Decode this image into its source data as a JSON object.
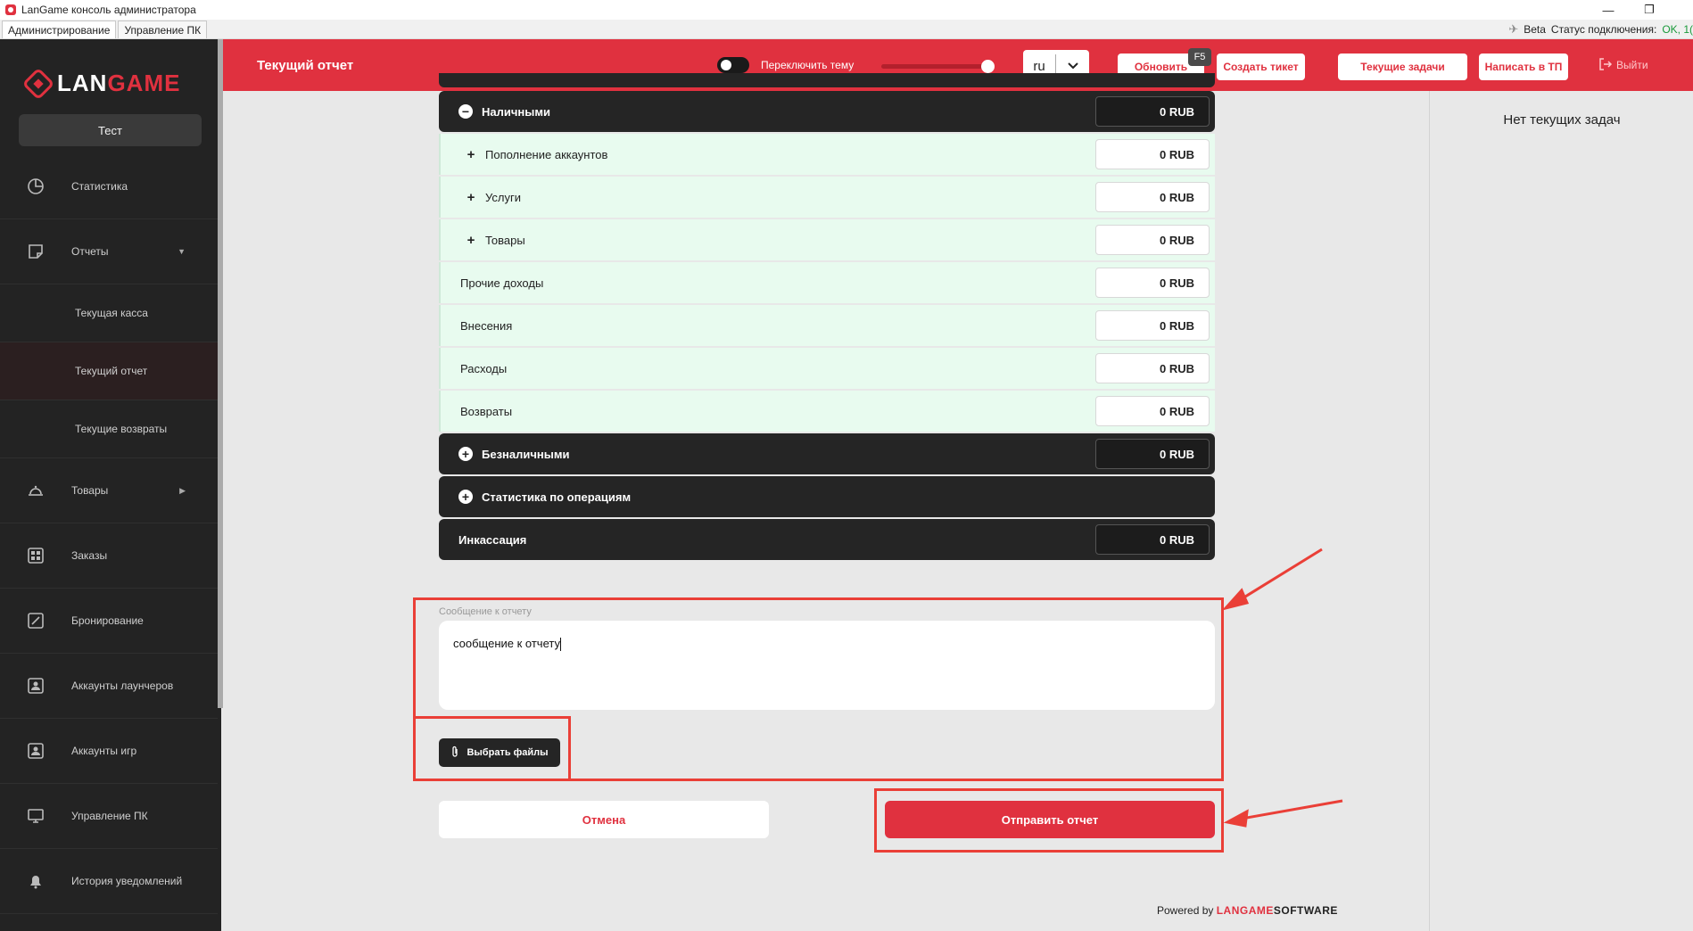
{
  "window": {
    "title": "LanGame консоль администратора",
    "tabs": [
      "Администрирование",
      "Управление ПК"
    ],
    "beta_label": "Beta",
    "status_label": "Статус подключения:",
    "status_value": "OK, 1("
  },
  "sidebar": {
    "logo_left": "LAN",
    "logo_right": "GAME",
    "club_button": "Тест",
    "items": [
      {
        "label": "Статистика",
        "icon": "pie-chart-icon"
      },
      {
        "label": "Отчеты",
        "icon": "note-icon"
      },
      {
        "label": "Текущая касса"
      },
      {
        "label": "Текущий отчет"
      },
      {
        "label": "Текущие возвраты"
      },
      {
        "label": "Товары",
        "icon": "cloche-icon"
      },
      {
        "label": "Заказы",
        "icon": "grid-icon"
      },
      {
        "label": "Бронирование",
        "icon": "edit-icon"
      },
      {
        "label": "Аккаунты лаунчеров",
        "icon": "account-icon"
      },
      {
        "label": "Аккаунты игр",
        "icon": "account-icon"
      },
      {
        "label": "Управление ПК",
        "icon": "monitor-icon"
      },
      {
        "label": "История уведомлений",
        "icon": "bell-icon"
      }
    ]
  },
  "header": {
    "title": "Текущий отчет",
    "theme_label": "Переключить тему",
    "language": "ru",
    "refresh": "Обновить",
    "refresh_hotkey": "F5",
    "create_ticket": "Создать тикет",
    "current_tasks": "Текущие задачи",
    "write_support": "Написать в ТП",
    "logout": "Выйти"
  },
  "report": {
    "rows": [
      {
        "label": "Наличными",
        "amount": "0 RUB",
        "style": "dark",
        "icon": "minus"
      },
      {
        "label": "Пополнение аккаунтов",
        "amount": "0 RUB",
        "style": "light",
        "icon": "plus"
      },
      {
        "label": "Услуги",
        "amount": "0 RUB",
        "style": "light",
        "icon": "plus"
      },
      {
        "label": "Товары",
        "amount": "0 RUB",
        "style": "light",
        "icon": "plus"
      },
      {
        "label": "Прочие доходы",
        "amount": "0 RUB",
        "style": "light"
      },
      {
        "label": "Внесения",
        "amount": "0 RUB",
        "style": "light"
      },
      {
        "label": "Расходы",
        "amount": "0 RUB",
        "style": "light"
      },
      {
        "label": "Возвраты",
        "amount": "0 RUB",
        "style": "light"
      },
      {
        "label": "Безналичными",
        "amount": "0 RUB",
        "style": "dark",
        "icon": "plus"
      },
      {
        "label": "Статистика по операциям",
        "style": "dark",
        "icon": "plus"
      },
      {
        "label": "Инкассация",
        "amount": "0 RUB",
        "style": "dark"
      }
    ],
    "message_label": "Сообщение к отчету",
    "message_value": "сообщение к отчету",
    "files_button": "Выбрать файлы",
    "cancel_button": "Отмена",
    "submit_button": "Отправить отчет",
    "powered_prefix": "Powered by",
    "powered_brand_red": "LANGAME",
    "powered_brand": "SOFTWARE"
  },
  "tasks_panel": {
    "empty_text": "Нет текущих задач"
  },
  "colors": {
    "accent": "#e0313f",
    "sidebar": "#232323",
    "annotation": "#ea3f37"
  }
}
